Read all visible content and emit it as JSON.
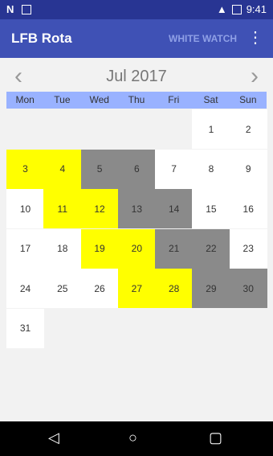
{
  "statusbar": {
    "time": "9:41"
  },
  "appbar": {
    "title": "LFB Rota",
    "action": "WHITE WATCH"
  },
  "calendar": {
    "month_label": "Jul 2017",
    "weekdays": [
      "Mon",
      "Tue",
      "Wed",
      "Thu",
      "Fri",
      "Sat",
      "Sun"
    ],
    "colors": {
      "yellow": "#ffff00",
      "gray": "#8a8a8a",
      "white": "#ffffff"
    },
    "cells": [
      {
        "d": "1",
        "col": 5,
        "row": 0,
        "c": "white"
      },
      {
        "d": "2",
        "col": 6,
        "row": 0,
        "c": "white"
      },
      {
        "d": "3",
        "col": 0,
        "row": 1,
        "c": "yellow"
      },
      {
        "d": "4",
        "col": 1,
        "row": 1,
        "c": "yellow"
      },
      {
        "d": "5",
        "col": 2,
        "row": 1,
        "c": "gray"
      },
      {
        "d": "6",
        "col": 3,
        "row": 1,
        "c": "gray"
      },
      {
        "d": "7",
        "col": 4,
        "row": 1,
        "c": "white"
      },
      {
        "d": "8",
        "col": 5,
        "row": 1,
        "c": "white"
      },
      {
        "d": "9",
        "col": 6,
        "row": 1,
        "c": "white"
      },
      {
        "d": "10",
        "col": 0,
        "row": 2,
        "c": "white"
      },
      {
        "d": "11",
        "col": 1,
        "row": 2,
        "c": "yellow"
      },
      {
        "d": "12",
        "col": 2,
        "row": 2,
        "c": "yellow"
      },
      {
        "d": "13",
        "col": 3,
        "row": 2,
        "c": "gray"
      },
      {
        "d": "14",
        "col": 4,
        "row": 2,
        "c": "gray"
      },
      {
        "d": "15",
        "col": 5,
        "row": 2,
        "c": "white"
      },
      {
        "d": "16",
        "col": 6,
        "row": 2,
        "c": "white"
      },
      {
        "d": "17",
        "col": 0,
        "row": 3,
        "c": "white"
      },
      {
        "d": "18",
        "col": 1,
        "row": 3,
        "c": "white"
      },
      {
        "d": "19",
        "col": 2,
        "row": 3,
        "c": "yellow"
      },
      {
        "d": "20",
        "col": 3,
        "row": 3,
        "c": "yellow"
      },
      {
        "d": "21",
        "col": 4,
        "row": 3,
        "c": "gray"
      },
      {
        "d": "22",
        "col": 5,
        "row": 3,
        "c": "gray"
      },
      {
        "d": "23",
        "col": 6,
        "row": 3,
        "c": "white"
      },
      {
        "d": "24",
        "col": 0,
        "row": 4,
        "c": "white"
      },
      {
        "d": "25",
        "col": 1,
        "row": 4,
        "c": "white"
      },
      {
        "d": "26",
        "col": 2,
        "row": 4,
        "c": "white"
      },
      {
        "d": "27",
        "col": 3,
        "row": 4,
        "c": "yellow"
      },
      {
        "d": "28",
        "col": 4,
        "row": 4,
        "c": "yellow"
      },
      {
        "d": "29",
        "col": 5,
        "row": 4,
        "c": "gray"
      },
      {
        "d": "30",
        "col": 6,
        "row": 4,
        "c": "gray"
      },
      {
        "d": "31",
        "col": 0,
        "row": 5,
        "c": "white"
      }
    ]
  }
}
